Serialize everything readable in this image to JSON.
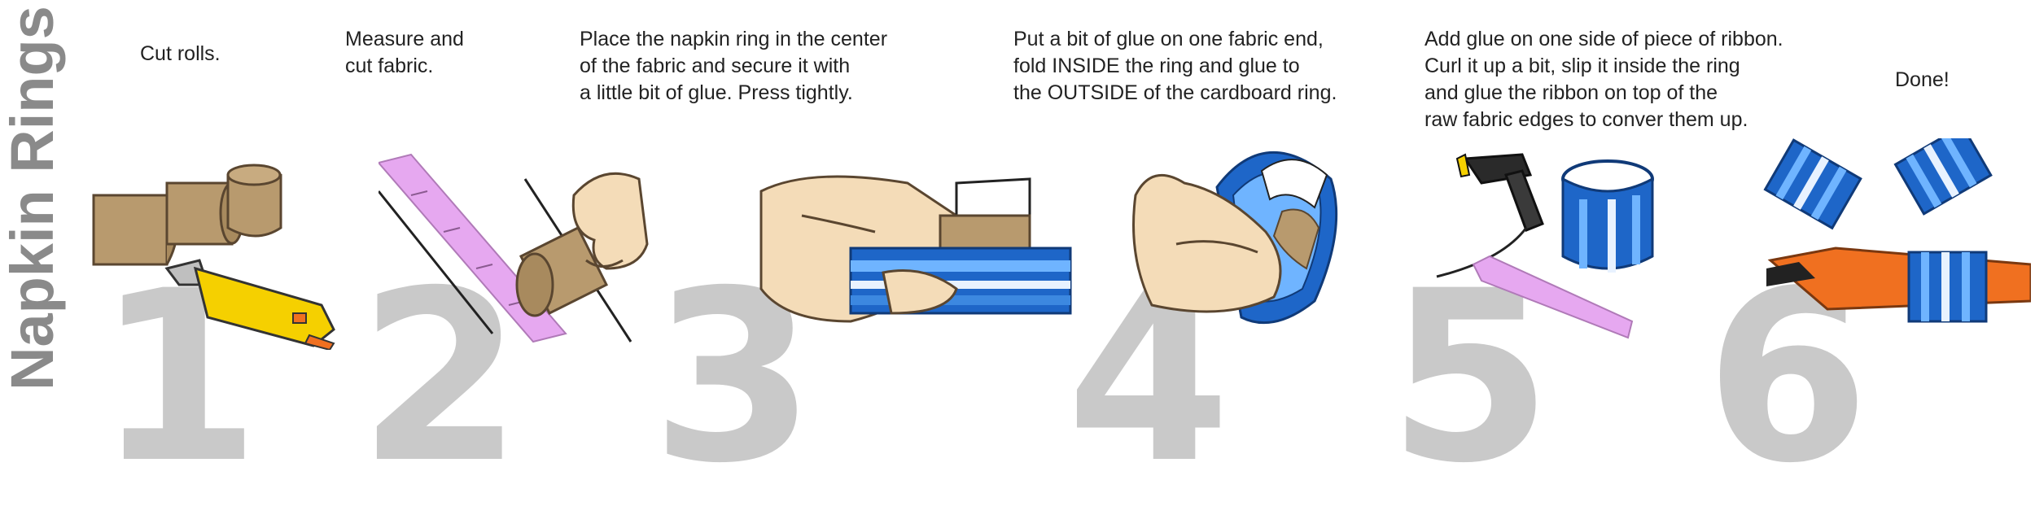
{
  "title": "Napkin Rings",
  "steps": [
    {
      "number": "1",
      "lines": [
        "Cut rolls."
      ]
    },
    {
      "number": "2",
      "lines": [
        "Measure and",
        "cut fabric."
      ]
    },
    {
      "number": "3",
      "lines": [
        "Place the napkin ring in the center",
        "of the fabric and secure it with",
        "a little bit of glue. Press tightly."
      ]
    },
    {
      "number": "4",
      "lines": [
        "Put a bit of glue on one fabric end,",
        "fold INSIDE the ring and glue to",
        "the OUTSIDE of the cardboard ring."
      ]
    },
    {
      "number": "5",
      "lines": [
        "Add glue on one side of piece of ribbon.",
        "Curl it up a bit, slip it inside the ring",
        "and glue the ribbon on top of the",
        "raw fabric edges to conver them up."
      ]
    },
    {
      "number": "6",
      "lines": [
        "Done!"
      ]
    }
  ],
  "colors": {
    "number": "#c9c9c9",
    "title": "#8a8a8a",
    "cardboard": "#b89a6e",
    "skin": "#f4dcb8",
    "blue": "#1e66c8",
    "ribbon": "#e6a8f0",
    "orange": "#f07020",
    "yellow": "#f5d000"
  }
}
